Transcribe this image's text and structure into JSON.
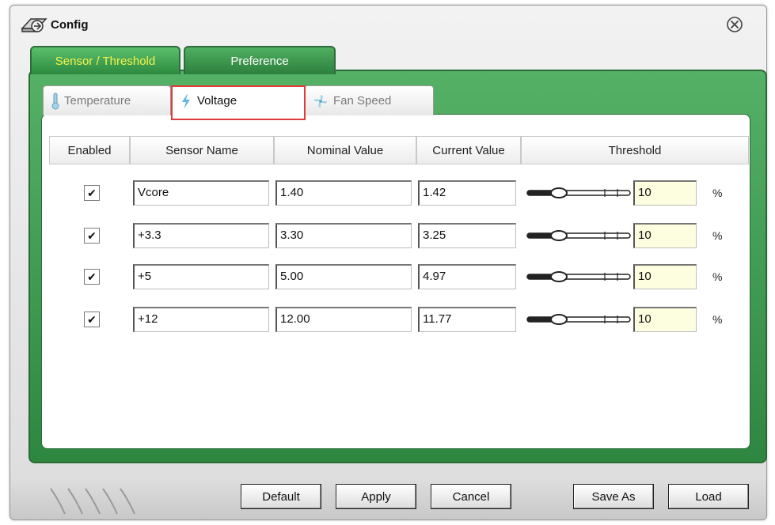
{
  "window": {
    "title": "Config"
  },
  "tabs": [
    {
      "label": "Sensor / Threshold",
      "active": true
    },
    {
      "label": "Preference",
      "active": false
    }
  ],
  "subtabs": [
    {
      "label": "Temperature",
      "icon": "thermometer-icon"
    },
    {
      "label": "Voltage",
      "icon": "lightning-icon",
      "active": true
    },
    {
      "label": "Fan Speed",
      "icon": "fan-icon"
    }
  ],
  "table": {
    "headers": [
      "Enabled",
      "Sensor Name",
      "Nominal Value",
      "Current Value",
      "Threshold"
    ],
    "rows": [
      {
        "enabled": "✔",
        "name": "Vcore",
        "nominal": "1.40",
        "current": "1.42",
        "threshold": "10",
        "unit": "%",
        "slider_level": 0.3
      },
      {
        "enabled": "✔",
        "name": "+3.3",
        "nominal": "3.30",
        "current": "3.25",
        "threshold": "10",
        "unit": "%",
        "slider_level": 0.3
      },
      {
        "enabled": "✔",
        "name": "+5",
        "nominal": "5.00",
        "current": "4.97",
        "threshold": "10",
        "unit": "%",
        "slider_level": 0.3
      },
      {
        "enabled": "✔",
        "name": "+12",
        "nominal": "12.00",
        "current": "11.77",
        "threshold": "10",
        "unit": "%",
        "slider_level": 0.3
      }
    ]
  },
  "buttons": {
    "default": "Default",
    "apply": "Apply",
    "cancel": "Cancel",
    "save_as": "Save As",
    "load": "Load"
  },
  "colors": {
    "panel_green": "#2e8740",
    "active_tab_text": "#f7f34a",
    "highlight_border": "#e03a3a",
    "threshold_field_bg": "#fdfde0"
  }
}
